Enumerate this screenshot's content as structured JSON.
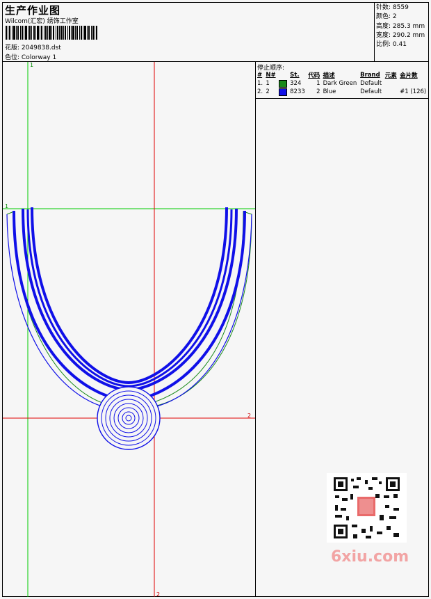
{
  "header": {
    "title": "生产作业图",
    "company": "Wilcom(汇宏) 绣饰工作室",
    "file_label": "花版:",
    "file_value": "2049838.dst",
    "colorway_label": "色位:",
    "colorway_value": "Colorway 1"
  },
  "stats": [
    {
      "label": "针数:",
      "value": "8559"
    },
    {
      "label": "颜色:",
      "value": "2"
    },
    {
      "label": "高度:",
      "value": "285.3 mm"
    },
    {
      "label": "宽度:",
      "value": "290.2 mm"
    },
    {
      "label": "比例:",
      "value": "0.41"
    }
  ],
  "sequence": {
    "title": "停止顺序:",
    "headers": [
      "#",
      "N#",
      "St.",
      "代码",
      "描述",
      "Brand",
      "元素",
      "金片数"
    ],
    "rows": [
      {
        "idx": "1.",
        "n": "1",
        "color": "#1b8a1b",
        "st": "324",
        "code": "1",
        "desc": "Dark Green",
        "brand": "Default",
        "element": "",
        "sequin": ""
      },
      {
        "idx": "2.",
        "n": "2",
        "color": "#1010e8",
        "st": "8233",
        "code": "2",
        "desc": "Blue",
        "brand": "Default",
        "element": "",
        "sequin": "#1 (126)"
      }
    ]
  },
  "guides": {
    "h1": "1",
    "v1": "1",
    "h2": "2",
    "v2": "2"
  },
  "watermark": {
    "brand_a": "6xiu",
    "brand_b": ".com"
  },
  "colors": {
    "green_guide": "#00cc00",
    "red_guide": "#e00000",
    "stitch_blue": "#1010e8",
    "stitch_green": "#1b8a1b"
  }
}
